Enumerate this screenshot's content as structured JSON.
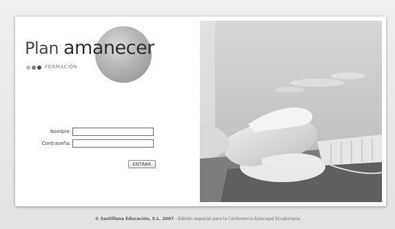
{
  "logo": {
    "word1": "Plan",
    "word2": "amanecer",
    "subtitle": "FORMACIÓN"
  },
  "form": {
    "nombre_label": "Nombre:",
    "nombre_value": "",
    "password_label": "Contraseña:",
    "password_value": "",
    "submit_label": "ENTRAR"
  },
  "photo": {
    "icon": "hand-on-mouse-photo"
  },
  "footer": {
    "copyright": "© Santillana Educación, S.L. 2007",
    "separator": " - ",
    "note": "Edición especial para la Conferencia Episcopal Ecuatoriana"
  }
}
